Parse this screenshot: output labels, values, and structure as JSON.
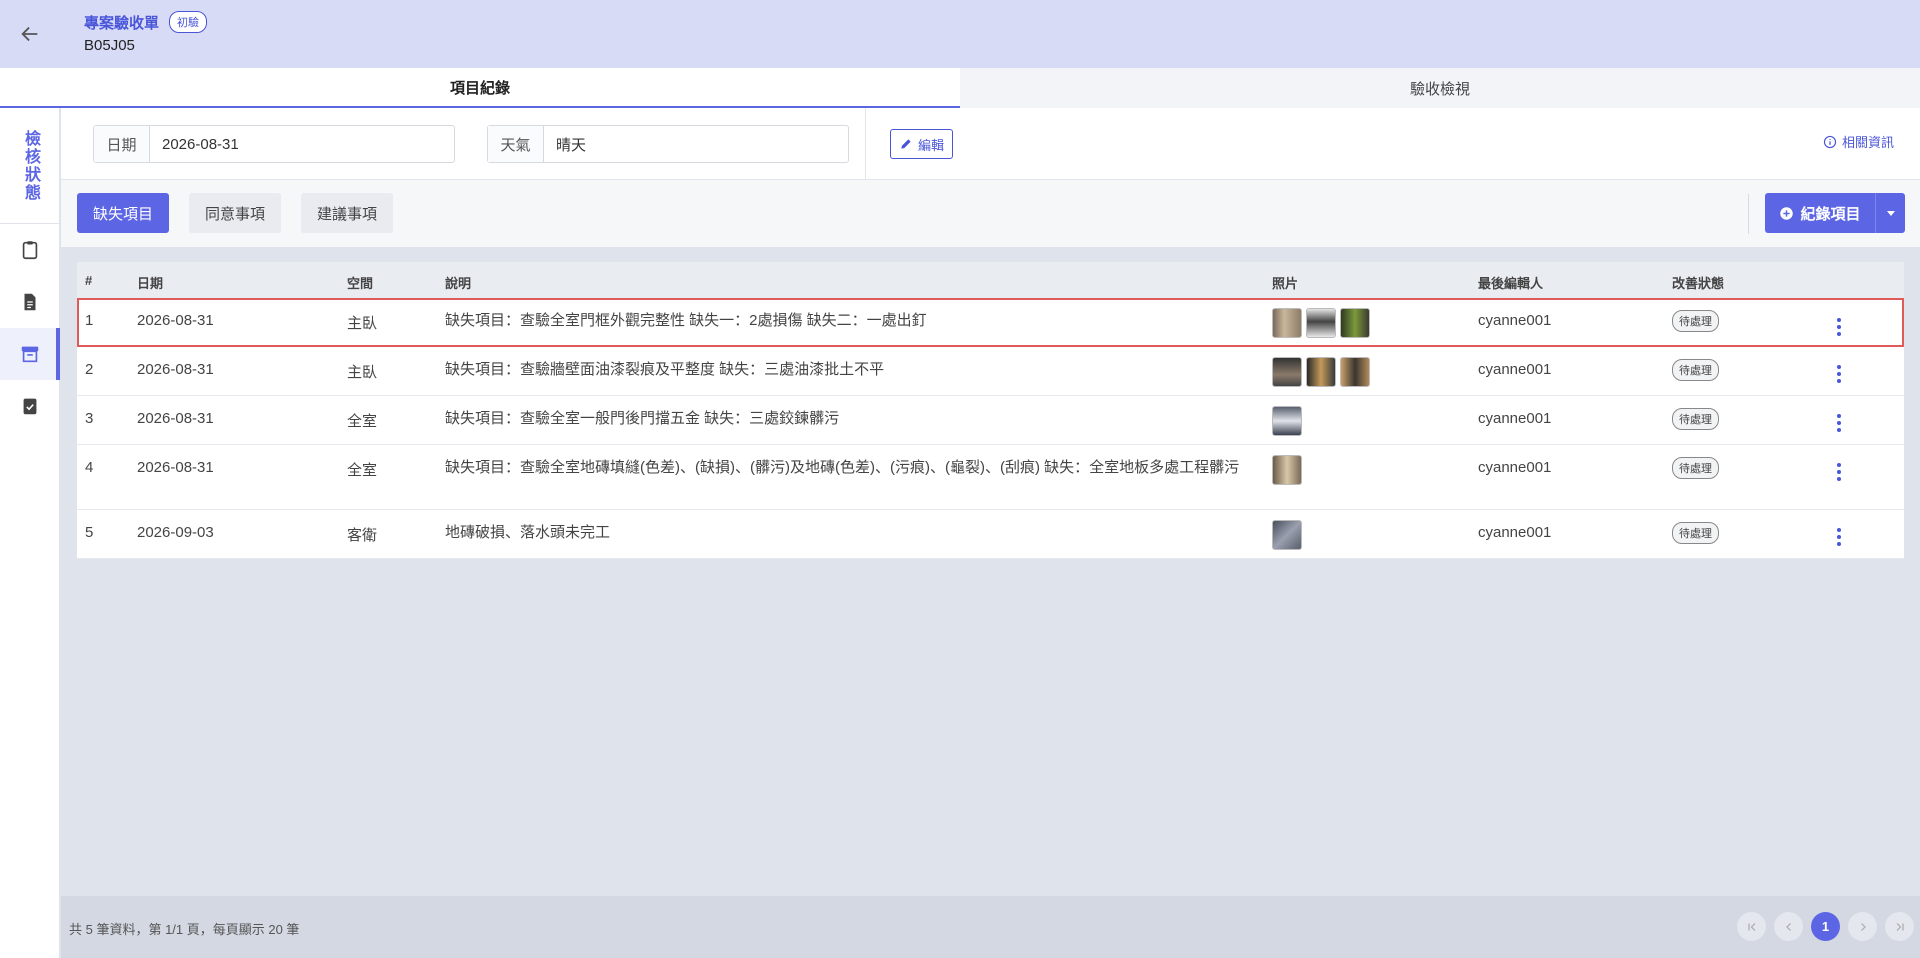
{
  "header": {
    "title": "專案驗收單",
    "badge": "初驗",
    "code": "B05J05"
  },
  "tabs": [
    {
      "label": "項目紀錄",
      "active": true
    },
    {
      "label": "驗收檢視",
      "active": false
    }
  ],
  "sidebar": {
    "status_label": "檢核狀態",
    "icons": [
      "clipboard-icon",
      "document-icon",
      "archive-icon",
      "clipboard-check-icon"
    ],
    "active_index": 2
  },
  "info": {
    "date_label": "日期",
    "date_value": "2026-08-31",
    "weather_label": "天氣",
    "weather_value": "晴天",
    "edit_label": "編輯",
    "related_label": "相關資訊"
  },
  "toolbar": {
    "buttons": [
      "缺失項目",
      "同意事項",
      "建議事項"
    ],
    "active_index": 0,
    "record_label": "紀錄項目"
  },
  "table": {
    "headers": [
      "#",
      "日期",
      "空間",
      "說明",
      "照片",
      "最後編輯人",
      "改善狀態"
    ],
    "rows": [
      {
        "num": "1",
        "date": "2026-08-31",
        "space": "主臥",
        "desc": "缺失項目：查驗全室門框外觀完整性 缺失一：2處損傷 缺失二：一處出釘",
        "photos": 3,
        "editor": "cyanne001",
        "status": "待處理"
      },
      {
        "num": "2",
        "date": "2026-08-31",
        "space": "主臥",
        "desc": "缺失項目：查驗牆壁面油漆裂痕及平整度 缺失：三處油漆批土不平",
        "photos": 3,
        "editor": "cyanne001",
        "status": "待處理"
      },
      {
        "num": "3",
        "date": "2026-08-31",
        "space": "全室",
        "desc": "缺失項目：查驗全室一般門後門擋五金 缺失：三處鉸鍊髒污",
        "photos": 1,
        "editor": "cyanne001",
        "status": "待處理"
      },
      {
        "num": "4",
        "date": "2026-08-31",
        "space": "全室",
        "desc": "缺失項目：查驗全室地磚填縫(色差)、(缺損)、(髒污)及地磚(色差)、(污痕)、(龜裂)、(刮痕) 缺失：全室地板多處工程髒污",
        "photos": 1,
        "editor": "cyanne001",
        "status": "待處理"
      },
      {
        "num": "5",
        "date": "2026-09-03",
        "space": "客衛",
        "desc": "地磚破損、落水頭未完工",
        "photos": 1,
        "editor": "cyanne001",
        "status": "待處理"
      }
    ]
  },
  "footer": {
    "summary": "共 5 筆資料，第 1/1 頁，每頁顯示 20 筆",
    "current_page": "1"
  },
  "colors": {
    "accent": "#5c66e4",
    "header_bg": "#d8dbf6",
    "highlight": "#e05a5a"
  }
}
